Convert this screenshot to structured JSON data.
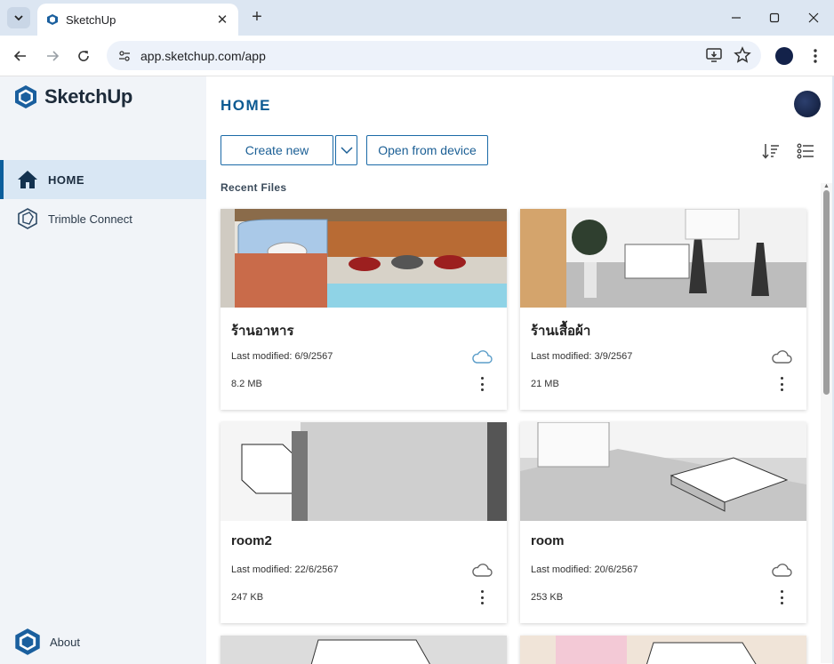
{
  "browser": {
    "tab_title": "SketchUp",
    "url": "app.sketchup.com/app"
  },
  "app": {
    "logo_text": "SketchUp",
    "page_title": "HOME",
    "sidebar": [
      {
        "label": "HOME",
        "icon": "home-icon",
        "active": true
      },
      {
        "label": "Trimble Connect",
        "icon": "trimble-connect-icon",
        "active": false
      }
    ],
    "about_label": "About",
    "create_new_label": "Create new",
    "open_from_device_label": "Open from device",
    "recent_files_label": "Recent Files",
    "files": [
      {
        "name": "ร้านอาหาร",
        "modified": "Last modified: 6/9/2567",
        "size": "8.2 MB"
      },
      {
        "name": "ร้านเสื้อผ้า",
        "modified": "Last modified: 3/9/2567",
        "size": "21 MB"
      },
      {
        "name": "room2",
        "modified": "Last modified: 22/6/2567",
        "size": "247 KB"
      },
      {
        "name": "room",
        "modified": "Last modified: 20/6/2567",
        "size": "253 KB"
      }
    ]
  },
  "colors": {
    "accent": "#0d5a92",
    "sidebar_active": "#d9e7f4",
    "button_border": "#1b6aa7"
  }
}
